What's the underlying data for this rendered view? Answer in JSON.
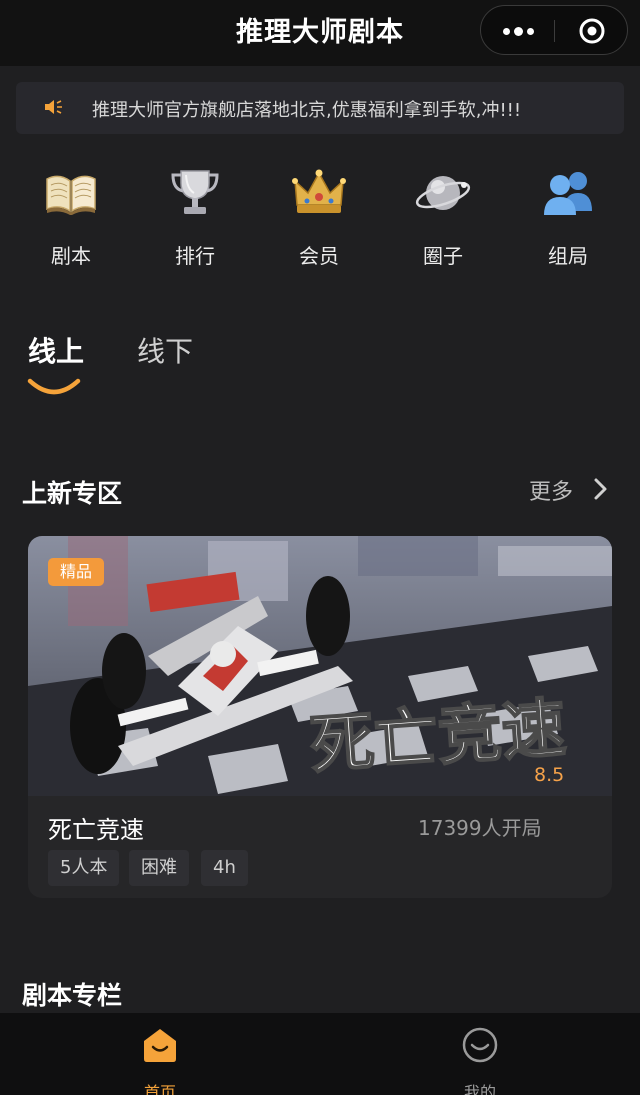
{
  "nav": {
    "title": "推理大师剧本"
  },
  "notice": {
    "text": "推理大师官方旗舰店落地北京,优惠福利拿到手软,冲!!!"
  },
  "categories": [
    {
      "label": "剧本",
      "icon": "book-icon"
    },
    {
      "label": "排行",
      "icon": "trophy-icon"
    },
    {
      "label": "会员",
      "icon": "crown-icon"
    },
    {
      "label": "圈子",
      "icon": "planet-icon"
    },
    {
      "label": "组局",
      "icon": "group-icon"
    }
  ],
  "tabs": [
    {
      "label": "线上",
      "active": true
    },
    {
      "label": "线下",
      "active": false
    }
  ],
  "sections": {
    "new": {
      "title": "上新专区",
      "more": "更多"
    },
    "column": {
      "title": "剧本专栏"
    }
  },
  "card": {
    "badge": "精品",
    "poster_title": "死亡竞速",
    "rating": "8.5",
    "name": "死亡竞速",
    "players": "17399人开局",
    "tags": [
      "5人本",
      "困难",
      "4h"
    ]
  },
  "tabbar": [
    {
      "label": "首页",
      "active": true,
      "icon": "home-icon"
    },
    {
      "label": "我的",
      "active": false,
      "icon": "profile-icon"
    }
  ],
  "colors": {
    "accent": "#f5a33a",
    "background": "#1f1f21",
    "card": "#262628"
  }
}
